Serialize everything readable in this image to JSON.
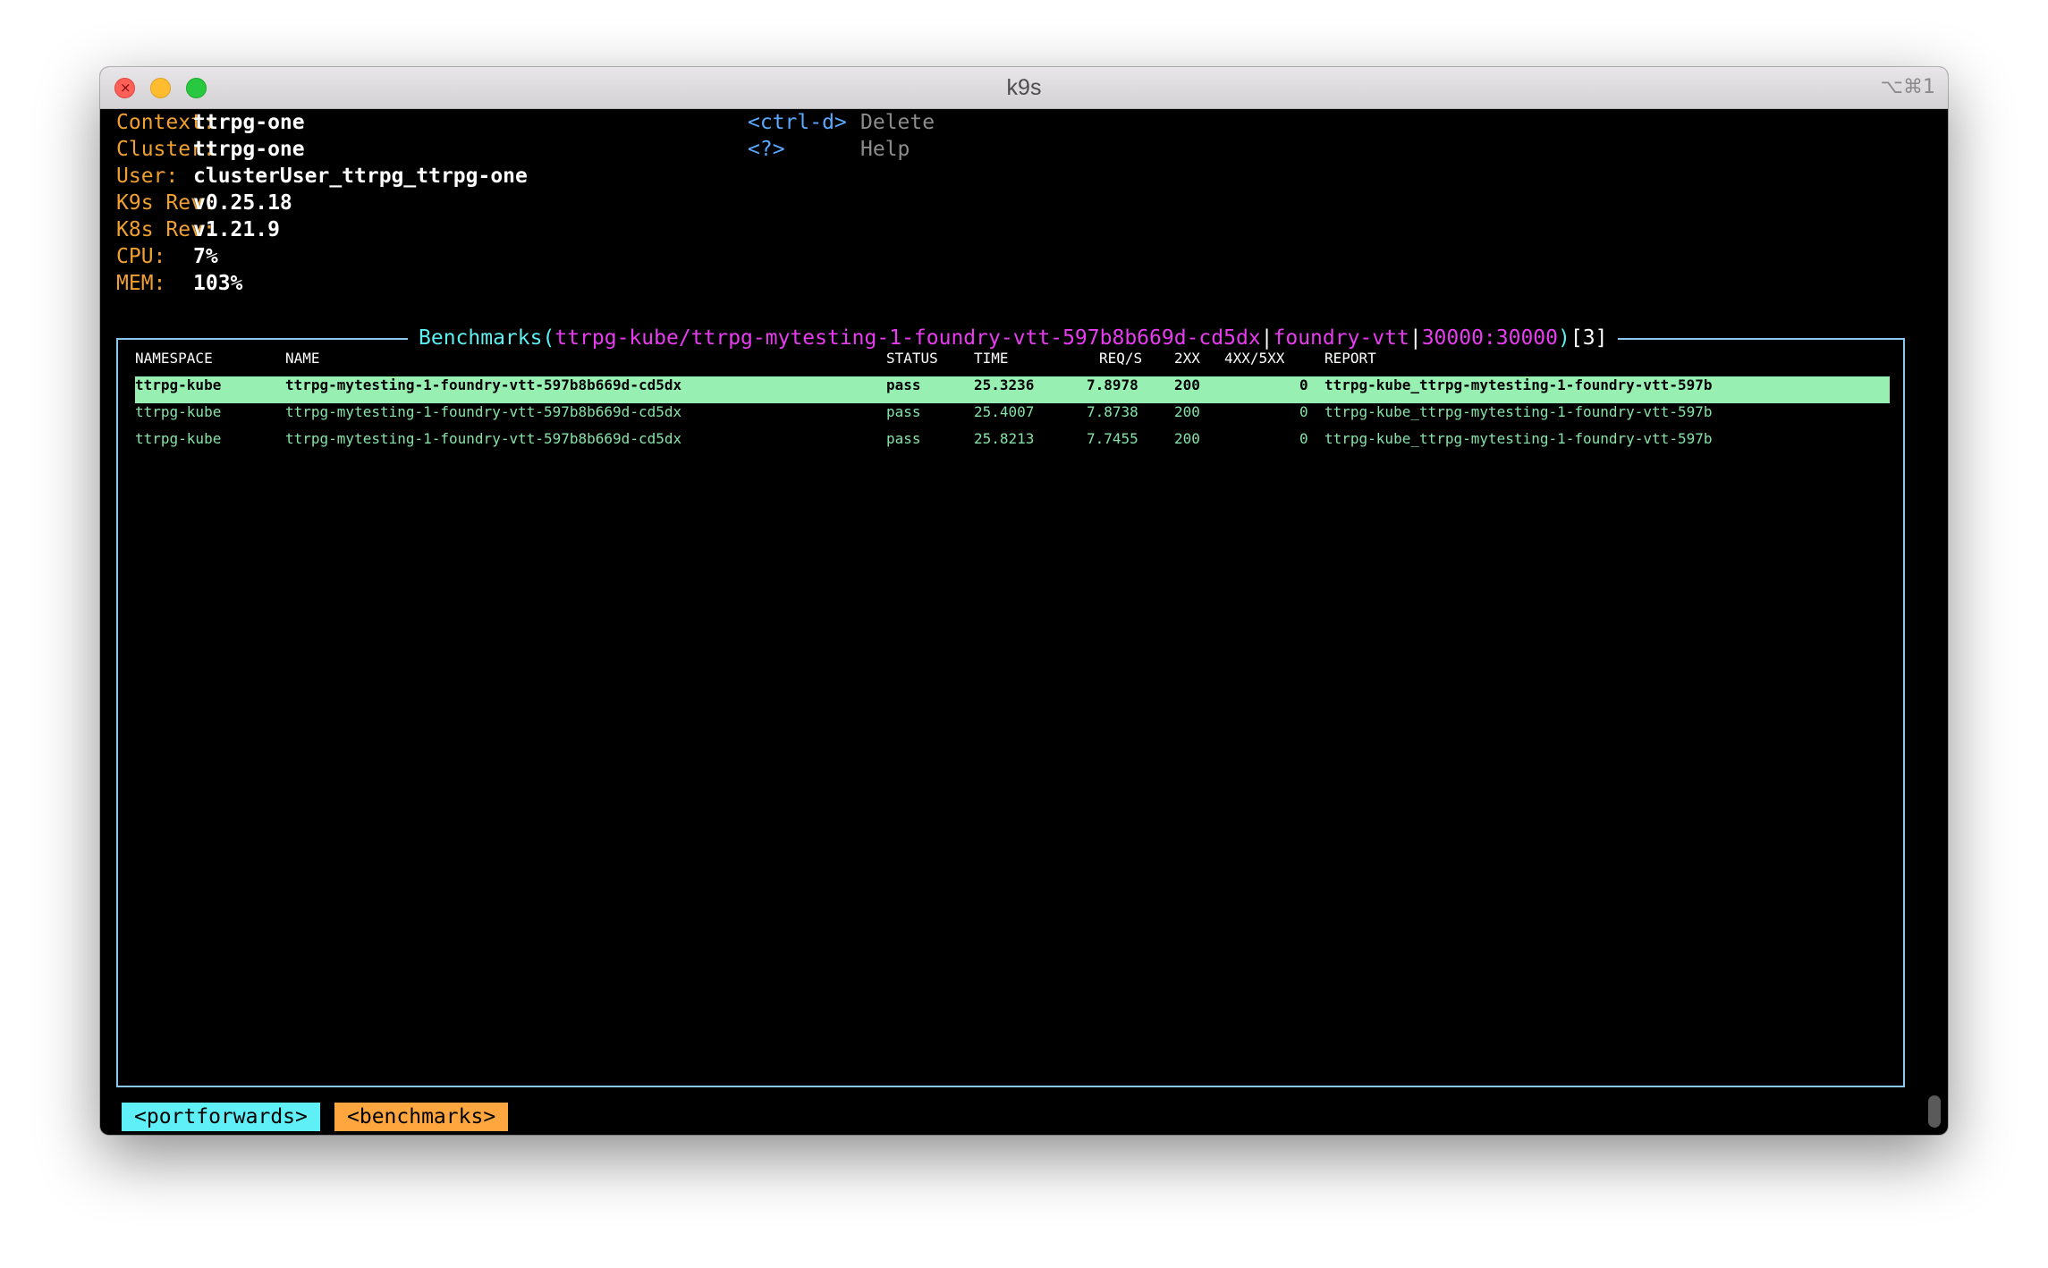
{
  "window": {
    "title": "k9s",
    "shortcut": "⌥⌘1"
  },
  "info": [
    {
      "label": "Context:",
      "value": "ttrpg-one"
    },
    {
      "label": "Cluster:",
      "value": "ttrpg-one"
    },
    {
      "label": "User:",
      "value": "clusterUser_ttrpg_ttrpg-one"
    },
    {
      "label": "K9s Rev:",
      "value": "v0.25.18"
    },
    {
      "label": "K8s Rev:",
      "value": "v1.21.9"
    },
    {
      "label": "CPU:",
      "value": "7%"
    },
    {
      "label": "MEM:",
      "value": "103%"
    }
  ],
  "hotkeys": [
    {
      "key": "<ctrl-d>",
      "desc": "Delete"
    },
    {
      "key": "<?>",
      "desc": "Help"
    }
  ],
  "view": {
    "title": "Benchmarks",
    "open_paren": "(",
    "path": "ttrpg-kube/ttrpg-mytesting-1-foundry-vtt-597b8b669d-cd5dx",
    "sep1": "|",
    "container": "foundry-vtt",
    "sep2": "|",
    "ports": "30000:30000",
    "close_paren": ")",
    "count": "[3]"
  },
  "table": {
    "headers": {
      "namespace": "NAMESPACE",
      "name": "NAME",
      "status": "STATUS",
      "time": "TIME",
      "reqs": "REQ/S",
      "c2xx": "2XX",
      "c45xx": "4XX/5XX",
      "report": "REPORT"
    },
    "rows": [
      {
        "namespace": "ttrpg-kube",
        "name": "ttrpg-mytesting-1-foundry-vtt-597b8b669d-cd5dx",
        "status": "pass",
        "time": "25.3236",
        "reqs": "7.8978",
        "c2xx": "200",
        "c45xx": "0",
        "report": "ttrpg-kube_ttrpg-mytesting-1-foundry-vtt-597b"
      },
      {
        "namespace": "ttrpg-kube",
        "name": "ttrpg-mytesting-1-foundry-vtt-597b8b669d-cd5dx",
        "status": "pass",
        "time": "25.4007",
        "reqs": "7.8738",
        "c2xx": "200",
        "c45xx": "0",
        "report": "ttrpg-kube_ttrpg-mytesting-1-foundry-vtt-597b"
      },
      {
        "namespace": "ttrpg-kube",
        "name": "ttrpg-mytesting-1-foundry-vtt-597b8b669d-cd5dx",
        "status": "pass",
        "time": "25.8213",
        "reqs": "7.7455",
        "c2xx": "200",
        "c45xx": "0",
        "report": "ttrpg-kube_ttrpg-mytesting-1-foundry-vtt-597b"
      }
    ]
  },
  "crumbs": [
    "<portforwards>",
    "<benchmarks>"
  ],
  "colors": {
    "label": "#f0a030",
    "key": "#5aa9ff",
    "frame": "#8cc7ee",
    "title_cyan": "#5cf0f0",
    "title_magenta": "#e83cf0",
    "row_text": "#86e2a8",
    "row_selected_bg": "#97f0b2",
    "crumb_active": "#5ff0f7",
    "crumb_current": "#ffa63e"
  }
}
